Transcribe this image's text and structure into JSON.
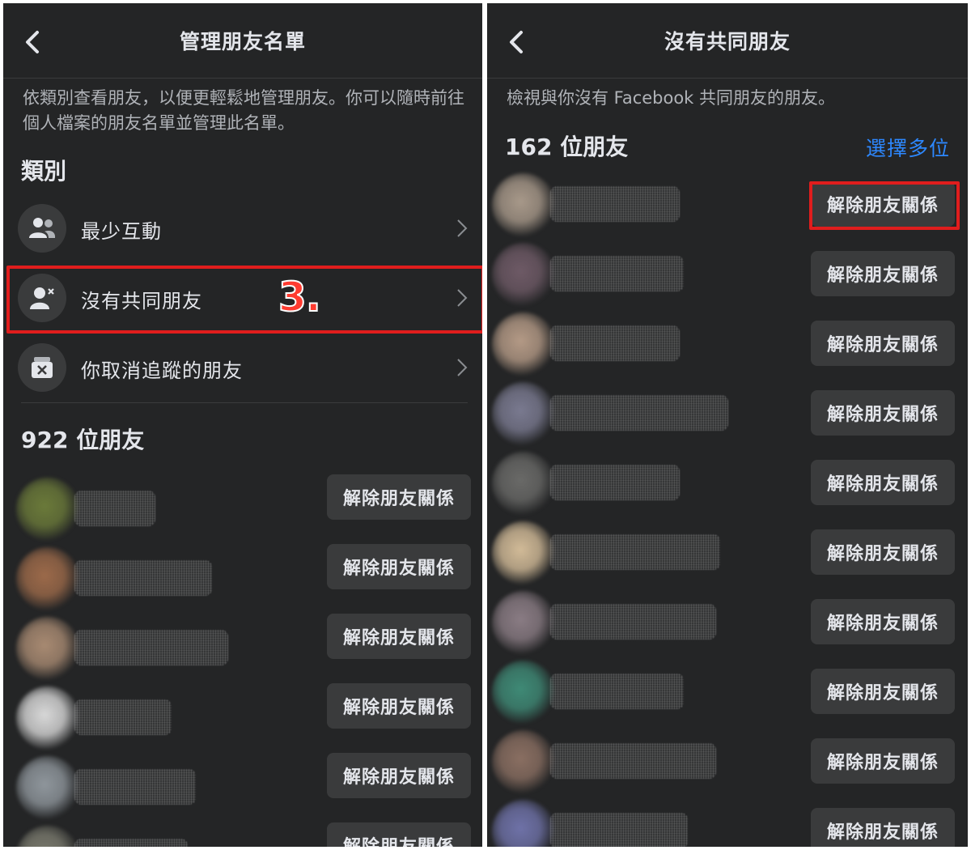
{
  "left": {
    "header": {
      "title": "管理朋友名單"
    },
    "description": "依類別查看朋友，以便更輕鬆地管理朋友。你可以隨時前往個人檔案的朋友名單並管理此名單。",
    "category_heading": "類別",
    "categories": [
      {
        "label": "最少互動",
        "icon": "people-icon"
      },
      {
        "label": "沒有共同朋友",
        "icon": "person-remove-icon"
      },
      {
        "label": "你取消追蹤的朋友",
        "icon": "unfollow-box-icon"
      }
    ],
    "annotation": "3.",
    "friend_count": "922 位朋友",
    "friends": [
      {
        "button": "解除朋友關係",
        "avatar_color": "#6b7a3a"
      },
      {
        "button": "解除朋友關係",
        "avatar_color": "#9c6a4a"
      },
      {
        "button": "解除朋友關係",
        "avatar_color": "#a88a72"
      },
      {
        "button": "解除朋友關係",
        "avatar_color": "#d8d8d8"
      },
      {
        "button": "解除朋友關係",
        "avatar_color": "#8f969c"
      },
      {
        "button": "解除朋友關係",
        "avatar_color": "#7a7a6e"
      }
    ]
  },
  "right": {
    "header": {
      "title": "沒有共同朋友"
    },
    "description": "檢視與你沒有 Facebook 共同朋友的朋友。",
    "friend_count": "162 位朋友",
    "select_multiple": "選擇多位",
    "friends": [
      {
        "button": "解除朋友關係",
        "avatar_color": "#a8998a"
      },
      {
        "button": "解除朋友關係",
        "avatar_color": "#6e5a66"
      },
      {
        "button": "解除朋友關係",
        "avatar_color": "#b49a86"
      },
      {
        "button": "解除朋友關係",
        "avatar_color": "#7a7a90"
      },
      {
        "button": "解除朋友關係",
        "avatar_color": "#6a6a68"
      },
      {
        "button": "解除朋友關係",
        "avatar_color": "#d2bb98"
      },
      {
        "button": "解除朋友關係",
        "avatar_color": "#8a7c84"
      },
      {
        "button": "解除朋友關係",
        "avatar_color": "#3f8a76"
      },
      {
        "button": "解除朋友關係",
        "avatar_color": "#8a6f62"
      },
      {
        "button": "解除朋友關係",
        "avatar_color": "#6f72a8"
      }
    ]
  },
  "colors": {
    "background": "#242526",
    "highlight": "#e01d1d",
    "link": "#2d88ff",
    "button": "#3a3b3c"
  }
}
